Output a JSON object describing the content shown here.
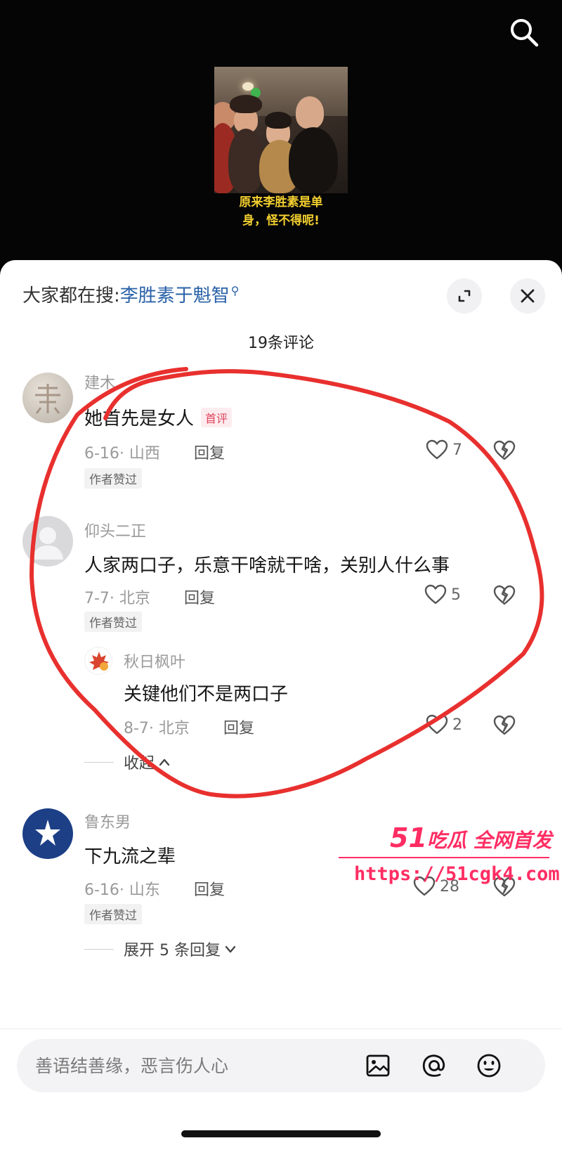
{
  "video": {
    "caption_line1": "原来李胜素是单",
    "caption_line2": "身，怪不得呢!"
  },
  "hot_search": {
    "prefix": "大家都在搜:",
    "keyword": "李胜素于魁智"
  },
  "comment_count": "19条评论",
  "comments": [
    {
      "username": "建木",
      "content": "她首先是女人",
      "badge": "首评",
      "date_location": "6-16· 山西",
      "reply": "回复",
      "likes": "7",
      "author_liked": "作者赞过"
    },
    {
      "username": "仰头二正",
      "content": "人家两口子，乐意干啥就干啥，关别人什么事",
      "date_location": "7-7· 北京",
      "reply": "回复",
      "likes": "5",
      "author_liked": "作者赞过"
    },
    {
      "username": "秋日枫叶",
      "content": "关键他们不是两口子",
      "date_location": "8-7· 北京",
      "reply": "回复",
      "likes": "2"
    },
    {
      "username": "鲁东男",
      "content": "下九流之辈",
      "date_location": "6-16· 山东",
      "reply": "回复",
      "likes": "28",
      "author_liked": "作者赞过"
    }
  ],
  "collapse_label": "收起",
  "expand_label": "展开 5 条回复",
  "watermark": {
    "num": "51",
    "text": "吃瓜 全网首发",
    "url": "https://51cgk4.com"
  },
  "input": {
    "placeholder": "善语结善缘，恶言伤人心"
  },
  "icons": [
    "search-icon",
    "expand-icon",
    "close-icon",
    "heart-icon",
    "broken-heart-icon",
    "chevron-up-icon",
    "chevron-down-icon",
    "image-icon",
    "at-icon",
    "emoji-icon"
  ],
  "colors": {
    "link": "#2a62a8",
    "badge": "#e0445c",
    "caption": "#f3cf2f",
    "watermark": "#ff2d63",
    "annotation": "#e8302e"
  }
}
